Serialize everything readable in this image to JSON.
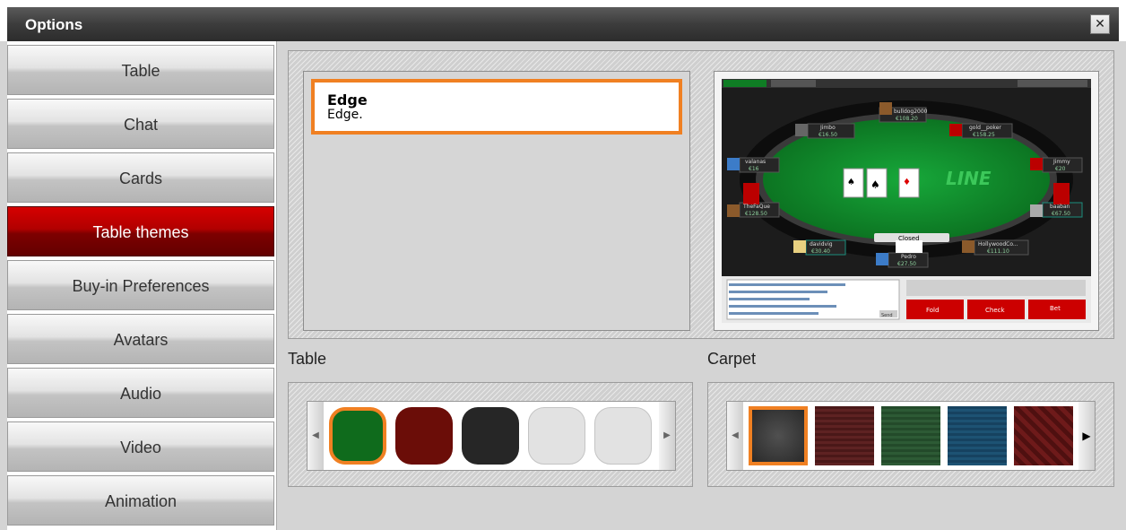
{
  "window": {
    "title": "Options",
    "close_symbol": "✕"
  },
  "sidebar": {
    "items": [
      {
        "label": "Table",
        "active": false
      },
      {
        "label": "Chat",
        "active": false
      },
      {
        "label": "Cards",
        "active": false
      },
      {
        "label": "Table themes",
        "active": true
      },
      {
        "label": "Buy-in Preferences",
        "active": false
      },
      {
        "label": "Avatars",
        "active": false
      },
      {
        "label": "Audio",
        "active": false
      },
      {
        "label": "Video",
        "active": false
      },
      {
        "label": "Animation",
        "active": false
      }
    ]
  },
  "themes": {
    "list": [
      {
        "name": "Edge",
        "description": "Edge.",
        "selected": true
      }
    ],
    "preview": {
      "players": [
        {
          "name": "bulldog2000",
          "stack": "€108.20"
        },
        {
          "name": "Jimbo",
          "stack": "€16.50"
        },
        {
          "name": "gold__poker",
          "stack": "€158.25"
        },
        {
          "name": "valanas",
          "stack": "€16"
        },
        {
          "name": "Jimmy",
          "stack": "€20"
        },
        {
          "name": "TheFaQue",
          "stack": "€128.50"
        },
        {
          "name": "baaban",
          "stack": "€67.50"
        },
        {
          "name": "davidvig",
          "stack": "€30.40"
        },
        {
          "name": "HollywoodCo...",
          "stack": "€111.10"
        },
        {
          "name": "Pedro",
          "stack": "€27.50"
        }
      ],
      "buttons": {
        "fold": "Fold",
        "check": "Check",
        "bet": "Bet",
        "send": "Send",
        "closed": "Closed"
      },
      "felt_text": "LINE"
    }
  },
  "table_section": {
    "label": "Table",
    "swatches": [
      {
        "name": "green",
        "color": "#0f6b1c",
        "selected": true
      },
      {
        "name": "dark-red",
        "color": "#6b0d08",
        "selected": false
      },
      {
        "name": "black",
        "color": "#262626",
        "selected": false
      },
      {
        "name": "light-grey-1",
        "color": "#e2e2e2",
        "selected": false
      },
      {
        "name": "light-grey-2",
        "color": "#e2e2e2",
        "selected": false
      }
    ]
  },
  "carpet_section": {
    "label": "Carpet",
    "swatches": [
      {
        "name": "charcoal",
        "color": "#3a3a3a",
        "selected": true
      },
      {
        "name": "maroon-stripes",
        "color": "#5e2222",
        "selected": false
      },
      {
        "name": "green-stripes",
        "color": "#2d5a35",
        "selected": false
      },
      {
        "name": "blue-stripes",
        "color": "#1d5273",
        "selected": false
      },
      {
        "name": "red-pattern",
        "color": "#6e1a1a",
        "selected": false
      }
    ]
  },
  "accent_color": "#f08022"
}
